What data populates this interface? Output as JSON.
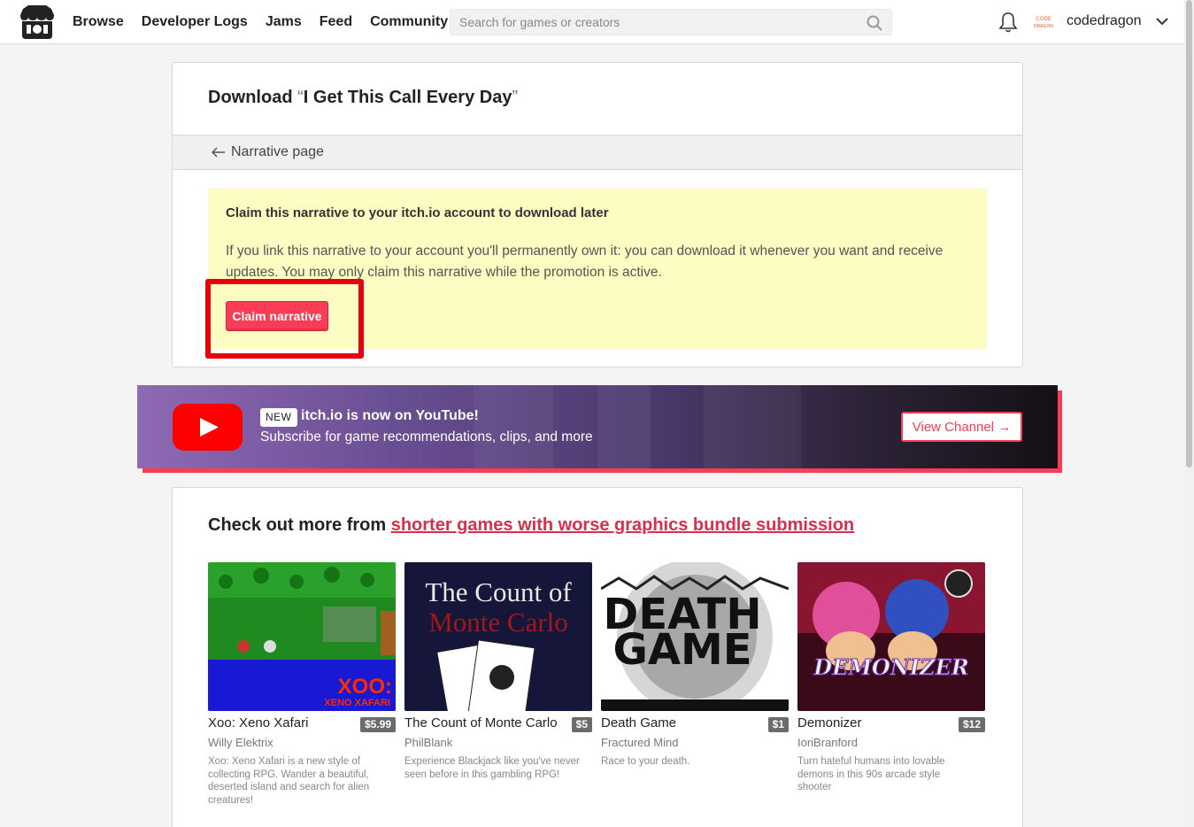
{
  "header": {
    "nav": [
      "Browse",
      "Developer Logs",
      "Jams",
      "Feed",
      "Community"
    ],
    "search_placeholder": "Search for games or creators",
    "username": "codedragon",
    "avatar_text": "CODE DRAGON"
  },
  "download": {
    "title_prefix": "Download ",
    "open_quote": "“",
    "title": "I Get This Call Every Day",
    "close_quote": "”",
    "back_link": "Narrative page",
    "claim_heading": "Claim this narrative to your itch.io account to download later",
    "claim_text": "If you link this narrative to your account you'll permanently own it: you can download it whenever you want and receive updates. You may only claim this narrative while the promotion is active.",
    "claim_button": "Claim narrative"
  },
  "youtube": {
    "badge": "NEW",
    "headline": "itch.io is now on YouTube!",
    "subline": "Subscribe for game recommendations, clips, and more",
    "button": "View Channel →"
  },
  "more": {
    "heading_prefix": "Check out more from ",
    "heading_link": "shorter games with worse graphics bundle submission",
    "games": [
      {
        "title": "Xoo: Xeno Xafari",
        "price": "$5.99",
        "author": "Willy Elektrix",
        "description": "Xoo: Xeno Xafari is a new style of collecting RPG. Wander a beautiful, deserted island and search for alien creatures!",
        "thumb_text": [
          "XOO:",
          "XENO XAFARI"
        ]
      },
      {
        "title": "The Count of Monte Carlo",
        "price": "$5",
        "author": "PhilBlank",
        "description": "Experience Blackjack like you've never seen before in this gambling RPG!",
        "thumb_text": [
          "The Count of",
          "Monte Carlo"
        ]
      },
      {
        "title": "Death Game",
        "price": "$1",
        "author": "Fractured Mind",
        "description": "Race to your death.",
        "thumb_text": [
          "DEATH",
          "GAME"
        ]
      },
      {
        "title": "Demonizer",
        "price": "$12",
        "author": "IoriBranford",
        "description": "Turn hateful humans into lovable demons in this 90s arcade style shooter",
        "thumb_text": [
          "DEMONIZER"
        ]
      }
    ]
  },
  "colors": {
    "accent": "#fa3c57",
    "claim_box": "#fdfcc2",
    "highlight": "#e8000f",
    "youtube_red": "#ff0000"
  }
}
